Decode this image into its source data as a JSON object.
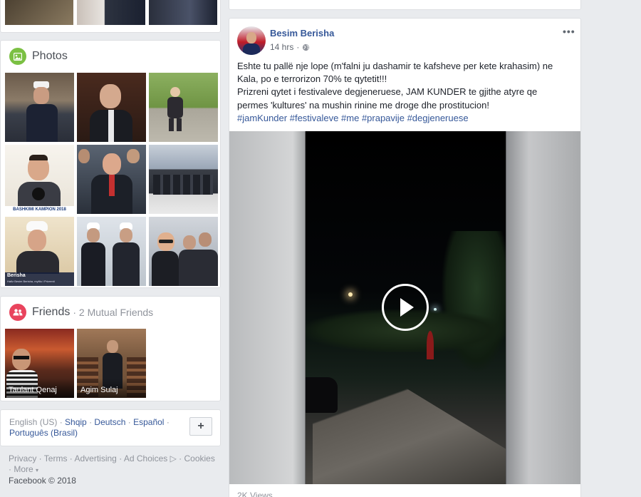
{
  "photos": {
    "title": "Photos",
    "items": [
      {
        "alt": "Speaker at podium with microphone"
      },
      {
        "alt": "Man in suit and glasses, portrait"
      },
      {
        "alt": "Child standing on grass"
      },
      {
        "alt": "Campaign poster with man smiling"
      },
      {
        "alt": "Man in suit among crowd"
      },
      {
        "alt": "Group walking at cemetery"
      },
      {
        "alt": "Imam portrait with caption"
      },
      {
        "alt": "Imams in robes standing"
      },
      {
        "alt": "Group selfie of men"
      }
    ],
    "poster_text": "BASHKIMI KAMPION 2018",
    "caption_name": "Berisha",
    "caption_line": "Hafiz Besim Berisha, myftiu i Prizrenit"
  },
  "friends": {
    "title": "Friends",
    "mutual": "· 2 Mutual Friends",
    "items": [
      {
        "name": "Taulant Qenaj"
      },
      {
        "name": "Agim Sulaj"
      }
    ]
  },
  "languages": {
    "items": [
      "English (US)",
      "Shqip",
      "Deutsch",
      "Español",
      "Português (Brasil)"
    ],
    "add_label": "+"
  },
  "footer": {
    "links": [
      "Privacy",
      "Terms",
      "Advertising",
      "Ad Choices",
      "Cookies",
      "More"
    ],
    "copyright": "Facebook © 2018"
  },
  "post": {
    "author": "Besim Berisha",
    "time": "14 hrs",
    "text_line1": "Eshte tu pallë nje lope (m'falni ju dashamir te kafsheve per kete krahasim) ne",
    "text_line2": "Kala, po e terrorizon 70% te qytetit!!!",
    "text_line3": "Prizreni qytet i festivaleve degjeneruese, JAM KUNDER te gjithe atyre qe",
    "text_line4": "permes 'kultures' na mushin rinine me droge dhe prostitucion!",
    "hashtags": [
      "#jamKunder",
      "#festivaleve",
      "#me",
      "#prapavije",
      "#degjeneruese"
    ],
    "views": "2K Views"
  }
}
